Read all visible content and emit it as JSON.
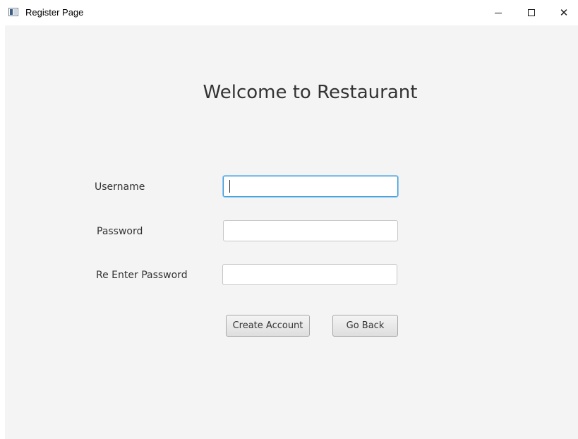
{
  "window": {
    "title": "Register Page",
    "controls": {
      "minimize": "minimize-icon",
      "maximize": "maximize-icon",
      "close": "close-icon",
      "close_glyph": "✕"
    }
  },
  "form": {
    "heading": "Welcome to Restaurant",
    "fields": [
      {
        "label": "Username",
        "value": "",
        "focused": true
      },
      {
        "label": "Password",
        "value": ""
      },
      {
        "label": "Re Enter Password",
        "value": ""
      }
    ],
    "buttons": {
      "create_account": "Create Account",
      "go_back": "Go Back"
    }
  },
  "colors": {
    "background": "#f4f4f4",
    "focus_accent": "#3a9ad9"
  }
}
